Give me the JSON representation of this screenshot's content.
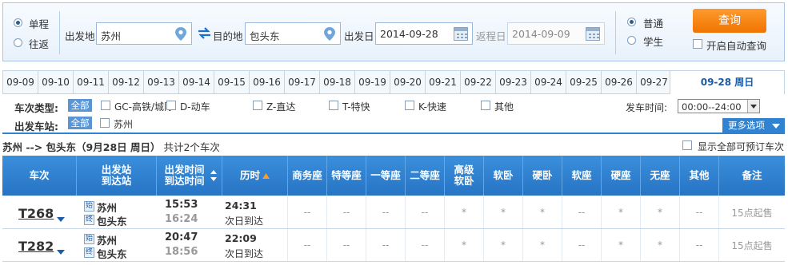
{
  "search": {
    "trip_type": {
      "one_way": "单程",
      "round_trip": "往返"
    },
    "from_label": "出发地",
    "from_value": "苏州",
    "to_label": "目的地",
    "to_value": "包头东",
    "depart_label": "出发日",
    "depart_value": "2014-09-28",
    "return_label": "返程日",
    "return_value": "2014-09-09",
    "passenger": {
      "normal": "普通",
      "student": "学生"
    },
    "search_button": "查询",
    "auto_query": "开启自动查询"
  },
  "dates": [
    "09-09",
    "09-10",
    "09-11",
    "09-12",
    "09-13",
    "09-14",
    "09-15",
    "09-16",
    "09-17",
    "09-18",
    "09-19",
    "09-20",
    "09-21",
    "09-22",
    "09-23",
    "09-24",
    "09-25",
    "09-26",
    "09-27"
  ],
  "active_date": "09-28  周日",
  "filters": {
    "train_type_label": "车次类型:",
    "all_label": "全部",
    "types": [
      "GC-高铁/城际",
      "D-动车",
      "Z-直达",
      "T-特快",
      "K-快速",
      "其他"
    ],
    "station_label": "出发车站:",
    "stations": [
      "苏州"
    ],
    "time_label": "发车时间:",
    "time_value": "00:00--24:00",
    "more_options": "更多选项"
  },
  "summary": {
    "route": "苏州 --> 包头东（9月28日  周日）",
    "count": "共计2个车次",
    "show_all": "显示全部可预订车次"
  },
  "table": {
    "headers": {
      "train": "车次",
      "station_from": "出发站",
      "station_to": "到达站",
      "time_depart": "出发时间",
      "time_arrive": "到达时间",
      "duration": "历时",
      "business": "商务座",
      "special": "特等座",
      "first": "一等座",
      "second": "二等座",
      "premium_top": "高级",
      "premium_bottom": "软卧",
      "soft_sleeper": "软卧",
      "hard_sleeper": "硬卧",
      "soft_seat": "软座",
      "hard_seat": "硬座",
      "no_seat": "无座",
      "other": "其他",
      "note": "备注"
    },
    "station_from_icon": "始",
    "station_to_icon": "终",
    "rows": [
      {
        "train": "T268",
        "from": "苏州",
        "to": "包头东",
        "depart": "15:53",
        "arrive": "16:24",
        "duration": "24:31",
        "arrival_day": "次日到达",
        "seats": [
          "--",
          "--",
          "--",
          "--",
          "*",
          "*",
          "*",
          "--",
          "*",
          "*",
          "--"
        ],
        "note": "15点起售"
      },
      {
        "train": "T282",
        "from": "苏州",
        "to": "包头东",
        "depart": "20:47",
        "arrive": "18:56",
        "duration": "22:09",
        "arrival_day": "次日到达",
        "seats": [
          "--",
          "--",
          "--",
          "--",
          "*",
          "*",
          "*",
          "--",
          "*",
          "*",
          "--"
        ],
        "note": "15点起售"
      }
    ]
  }
}
